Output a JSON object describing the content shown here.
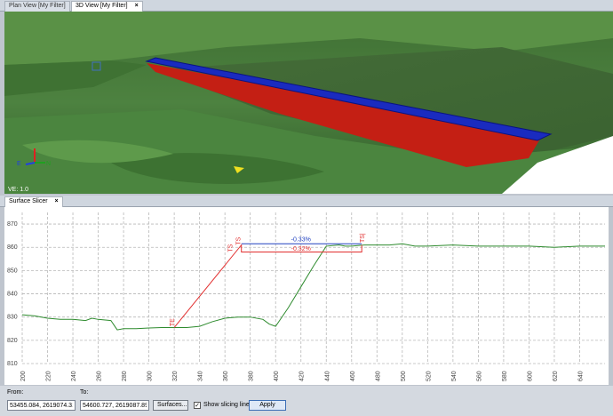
{
  "top_tabs": [
    {
      "label": "Plan View [My Filter]",
      "active": false
    },
    {
      "label": "3D View [My Filter]",
      "active": true
    }
  ],
  "close_glyph": "×",
  "viewport": {
    "ve_label": "VE: 1.0",
    "axis_labels": {
      "east": "E",
      "north": "N"
    }
  },
  "slicer_tab": {
    "label": "Surface Slicer"
  },
  "chart_data": {
    "type": "line",
    "title": "",
    "xlabel": "",
    "ylabel": "",
    "xlim": [
      200,
      660
    ],
    "ylim": [
      810,
      875
    ],
    "x_ticks": [
      200,
      220,
      240,
      260,
      280,
      300,
      320,
      340,
      360,
      380,
      400,
      420,
      440,
      460,
      480,
      500,
      520,
      540,
      560,
      580,
      600,
      620,
      640
    ],
    "y_ticks": [
      810,
      820,
      830,
      840,
      850,
      860,
      870
    ],
    "grid": true,
    "series": [
      {
        "color": "#2e8b2e",
        "x": [
          200,
          210,
          220,
          230,
          240,
          250,
          255,
          260,
          270,
          275,
          280,
          290,
          300,
          310,
          320,
          330,
          340,
          350,
          360,
          370,
          380,
          390,
          395,
          400,
          410,
          420,
          430,
          440,
          450,
          455,
          460,
          470,
          480,
          490,
          500,
          510,
          520,
          540,
          560,
          580,
          600,
          620,
          640,
          660
        ],
        "y": [
          831,
          830.5,
          829.5,
          829,
          829,
          828.5,
          829.5,
          829,
          828.5,
          824.5,
          825,
          825,
          825.3,
          825.5,
          825.5,
          825.5,
          826,
          828,
          829.5,
          830,
          830,
          829,
          827,
          826,
          834,
          843,
          852,
          860.5,
          861,
          860.5,
          860.5,
          861,
          861,
          861,
          861.5,
          860.5,
          860.5,
          861,
          860.5,
          860.5,
          860.5,
          860,
          860.5,
          860.5
        ]
      },
      {
        "color": "#e23030",
        "x": [
          320,
          373,
          373,
          468,
          468
        ],
        "y": [
          825.5,
          861,
          858,
          858,
          861
        ]
      },
      {
        "color": "#2040c0",
        "x": [
          373,
          468
        ],
        "y": [
          861.5,
          861.5
        ]
      }
    ],
    "annotations": [
      {
        "text": "TE",
        "x": 320,
        "y": 826,
        "color": "#e23030",
        "rotate": true
      },
      {
        "text": "TS",
        "x": 366,
        "y": 858,
        "color": "#e23030",
        "rotate": true
      },
      {
        "text": "TS",
        "x": 372,
        "y": 861,
        "color": "#e23030",
        "rotate": true
      },
      {
        "text": "TS|",
        "x": 470,
        "y": 862,
        "color": "#e23030",
        "rotate": true
      },
      {
        "text": "-0.33%",
        "x": 420,
        "y": 862.5,
        "color": "#2040c0",
        "rotate": false
      },
      {
        "text": "-0.32%",
        "x": 420,
        "y": 858.6,
        "color": "#e23030",
        "rotate": false
      }
    ]
  },
  "bottom_bar": {
    "from_label": "From:",
    "from_value": "53455.084, 2619074.311",
    "to_label": "To:",
    "to_value": "54600.727, 2619087.893",
    "surfaces_button": "Surfaces...",
    "show_slicing_label": "Show slicing line",
    "show_slicing_checked": true,
    "apply_button": "Apply"
  }
}
